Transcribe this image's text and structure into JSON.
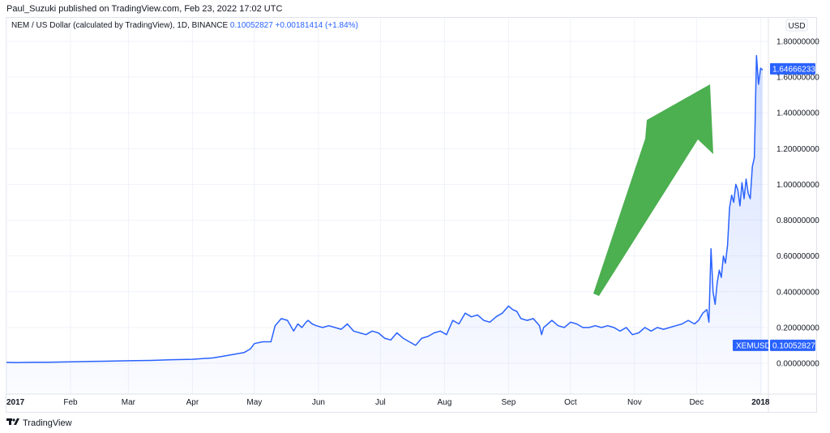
{
  "header": {
    "published": "Paul_Suzuki published on TradingView.com, Feb 23, 2022 17:02 UTC"
  },
  "legend": {
    "symbol": "NEM / US Dollar (calculated by TradingView), 1D, BINANCE",
    "price": "0.10052827",
    "change": "+0.00181414 (+1.84%)"
  },
  "currency_label": "USD",
  "footer": {
    "brand": "TradingView",
    "logo_icon": "tradingview-logo-icon"
  },
  "colors": {
    "line": "#2962ff",
    "arrow": "#4caf50",
    "label_bg": "#2962ff"
  },
  "chart_data": {
    "type": "area",
    "y_ticks": [
      "1.80000000",
      "1.60000000",
      "1.40000000",
      "1.20000000",
      "1.00000000",
      "0.80000000",
      "0.60000000",
      "0.40000000",
      "0.20000000",
      "0.00000000"
    ],
    "y_tick_values": [
      1.8,
      1.6,
      1.4,
      1.2,
      1.0,
      0.8,
      0.6,
      0.4,
      0.2,
      0.0
    ],
    "ylim": [
      0,
      1.8
    ],
    "x_ticks": [
      "2017",
      "Feb",
      "Mar",
      "Apr",
      "May",
      "Jun",
      "Jul",
      "Aug",
      "Sep",
      "Oct",
      "Nov",
      "Dec",
      "2018"
    ],
    "x_tick_days": [
      0,
      31,
      59,
      90,
      120,
      151,
      181,
      212,
      243,
      273,
      304,
      334,
      365
    ],
    "xlim_days": [
      0,
      368
    ],
    "grid": true,
    "last_price_label": "1.64666233",
    "symbol_label": "XEMUSD",
    "symbol_value": "0.10052827",
    "symbol_value_num": 0.10052827,
    "annotation": "arrow-up",
    "series": [
      {
        "days": [
          0,
          5,
          10,
          15,
          20,
          25,
          31,
          40,
          50,
          59,
          70,
          80,
          90,
          100,
          105,
          110,
          115,
          118,
          120,
          124,
          128,
          130,
          133,
          136,
          139,
          141,
          143,
          145,
          146,
          148,
          150,
          153,
          156,
          159,
          162,
          165,
          168,
          171,
          174,
          177,
          180,
          183,
          186,
          189,
          192,
          195,
          198,
          201,
          204,
          207,
          210,
          213,
          216,
          219,
          222,
          225,
          228,
          231,
          234,
          237,
          240,
          243,
          245,
          247,
          249,
          252,
          255,
          258,
          259,
          260,
          262,
          264,
          267,
          270,
          273,
          276,
          279,
          282,
          285,
          288,
          291,
          294,
          297,
          300,
          303,
          306,
          309,
          312,
          315,
          318,
          321,
          324,
          327,
          330,
          333,
          335,
          337,
          339,
          340,
          341,
          342,
          343,
          344,
          345,
          346,
          347,
          348,
          349,
          350,
          351,
          352,
          353,
          354,
          355,
          356,
          357,
          358,
          359,
          360,
          361,
          362,
          363,
          364,
          365,
          366
        ],
        "values": [
          0.005,
          0.004,
          0.005,
          0.006,
          0.006,
          0.007,
          0.008,
          0.01,
          0.012,
          0.014,
          0.016,
          0.02,
          0.022,
          0.03,
          0.04,
          0.05,
          0.06,
          0.08,
          0.11,
          0.12,
          0.12,
          0.21,
          0.25,
          0.24,
          0.18,
          0.22,
          0.2,
          0.23,
          0.24,
          0.22,
          0.21,
          0.2,
          0.21,
          0.2,
          0.19,
          0.22,
          0.18,
          0.17,
          0.16,
          0.18,
          0.17,
          0.14,
          0.13,
          0.17,
          0.14,
          0.12,
          0.1,
          0.14,
          0.15,
          0.17,
          0.18,
          0.16,
          0.24,
          0.22,
          0.28,
          0.26,
          0.27,
          0.24,
          0.23,
          0.26,
          0.28,
          0.32,
          0.3,
          0.29,
          0.25,
          0.24,
          0.25,
          0.21,
          0.16,
          0.2,
          0.22,
          0.24,
          0.21,
          0.2,
          0.23,
          0.22,
          0.2,
          0.2,
          0.21,
          0.2,
          0.21,
          0.2,
          0.18,
          0.2,
          0.16,
          0.17,
          0.2,
          0.18,
          0.2,
          0.19,
          0.2,
          0.21,
          0.22,
          0.24,
          0.22,
          0.24,
          0.28,
          0.3,
          0.23,
          0.64,
          0.4,
          0.33,
          0.45,
          0.52,
          0.48,
          0.6,
          0.56,
          0.66,
          0.87,
          0.94,
          0.9,
          1.0,
          0.97,
          0.88,
          1.01,
          0.92,
          1.03,
          0.95,
          0.92,
          1.1,
          1.15,
          1.72,
          1.56,
          1.65,
          1.64
        ]
      }
    ]
  }
}
